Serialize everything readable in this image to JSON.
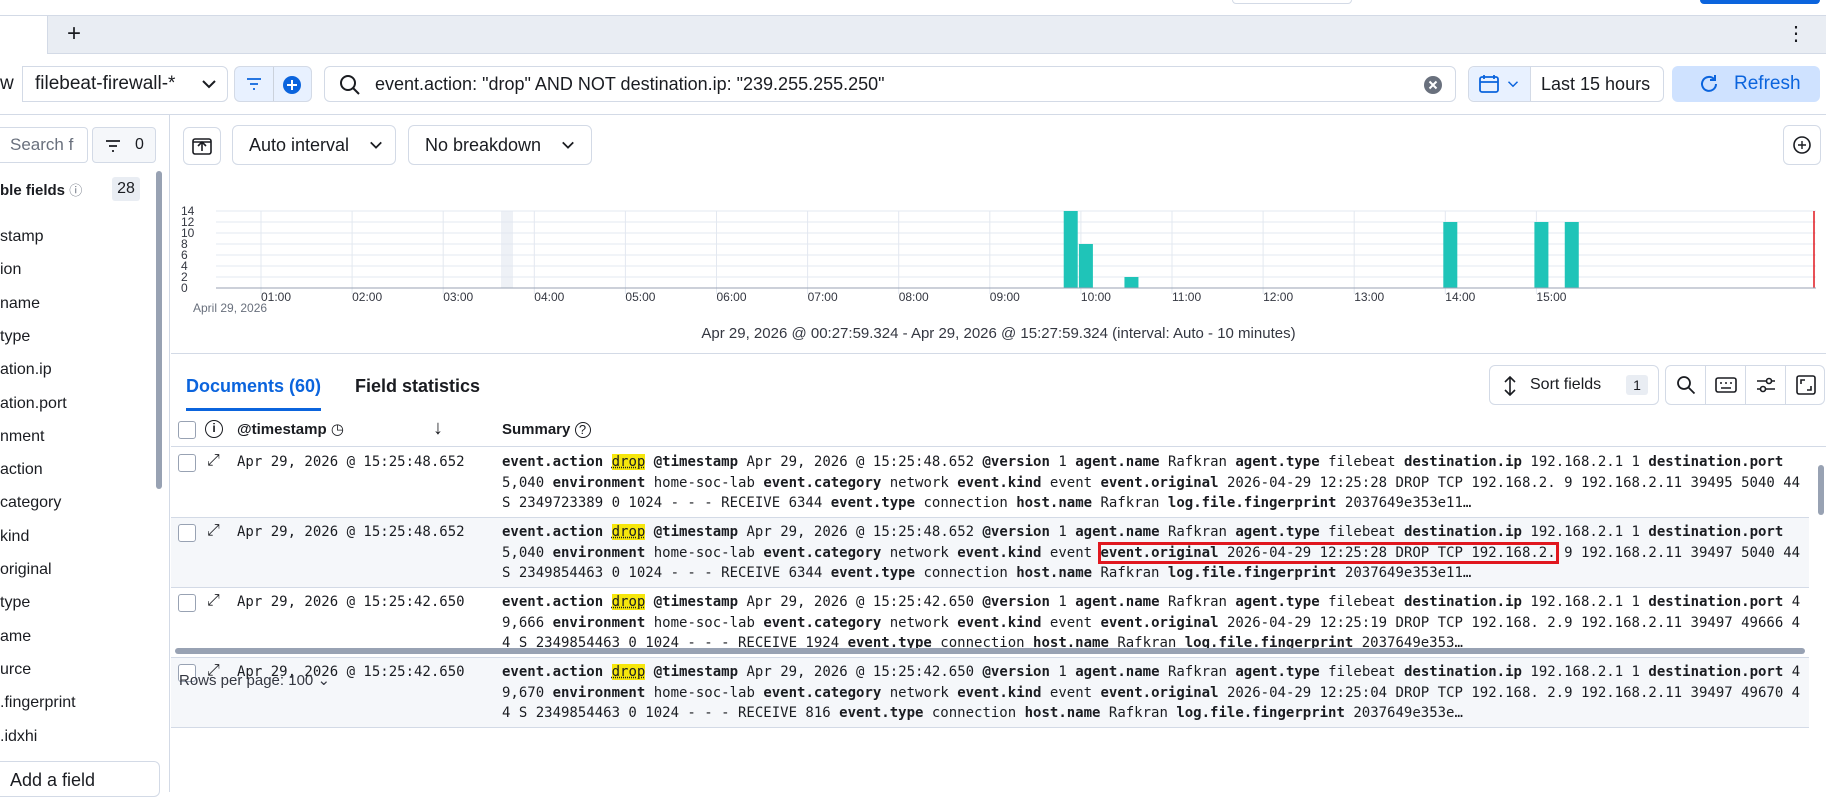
{
  "tabbar": {
    "add_tab": "+",
    "more": "⋮"
  },
  "query": {
    "dataview_prefix": "w",
    "dataview": "filebeat-firewall-*",
    "text": "event.action: \"drop\" AND NOT destination.ip: \"239.255.255.250\"",
    "date_range": "Last 15 hours",
    "refresh": "Refresh"
  },
  "sidebar": {
    "search_placeholder": "Search f",
    "filter_count": "0",
    "section_label": "ble fields",
    "section_count": "28",
    "items": [
      "stamp",
      "ion",
      "name",
      "type",
      "ation.ip",
      "ation.port",
      "nment",
      "action",
      "category",
      "kind",
      "original",
      "type",
      "ame",
      "urce",
      ".fingerprint",
      ".idxhi"
    ],
    "add_field": "Add a field"
  },
  "toolbar": {
    "interval": "Auto interval",
    "breakdown": "No breakdown"
  },
  "chart_data": {
    "type": "bar",
    "y_ticks": [
      "14",
      "12",
      "10",
      "8",
      "6",
      "4",
      "2",
      "0"
    ],
    "x_ticks": [
      "01:00",
      "02:00",
      "03:00",
      "04:00",
      "05:00",
      "06:00",
      "07:00",
      "08:00",
      "09:00",
      "10:00",
      "11:00",
      "12:00",
      "13:00",
      "14:00",
      "15:00"
    ],
    "x_date_label": "April 29, 2026",
    "ylim": [
      0,
      14
    ],
    "bars": [
      {
        "time": "09:50",
        "value": 14
      },
      {
        "time": "10:00",
        "value": 8
      },
      {
        "time": "10:30",
        "value": 2
      },
      {
        "time": "14:00",
        "value": 12
      },
      {
        "time": "15:00",
        "value": 12
      },
      {
        "time": "15:20",
        "value": 12
      }
    ],
    "color": "#1fc4b8",
    "grid": true
  },
  "interval_text": "Apr 29, 2026 @ 00:27:59.324 - Apr 29, 2026 @ 15:27:59.324 (interval: Auto - 10 minutes)",
  "tabs": {
    "documents": "Documents (60)",
    "field_stats": "Field statistics"
  },
  "sort": {
    "label": "Sort fields",
    "count": "1"
  },
  "table": {
    "col_timestamp": "@timestamp",
    "col_summary": "Summary",
    "rows": [
      {
        "ts": "Apr 29, 2026 @ 15:25:48.652",
        "a": "event.action ",
        "hl": "drop",
        "b": " @timestamp Apr 29, 2026 @ 15:25:48.652 @version 1 agent.name Rafkran agent.type filebeat destination.ip 192.168.2.1 1 destination.port 5,040 environment home-soc-lab event.category network event.kind event ",
        "c": "event.original 2026-04-29 12:25:28 DROP TCP 192.168.2.",
        "d": " 9 192.168.2.11 39495 5040 44 S 2349723389 0 1024 - - - RECEIVE 6344 event.type connection host.name Rafkran log.file.fingerprint 2037649e353e11…",
        "boxed": false
      },
      {
        "ts": "Apr 29, 2026 @ 15:25:48.652",
        "a": "event.action ",
        "hl": "drop",
        "b": " @timestamp Apr 29, 2026 @ 15:25:48.652 @version 1 agent.name Rafkran agent.type filebeat destination.ip 192.168.2.1 1 destination.port 5,040 environment home-soc-lab event.category network event.kind event ",
        "c": "event.original 2026-04-29 12:25:28 DROP TCP 192.168.2.",
        "d": " 9 192.168.2.11 39497 5040 44 S 2349854463 0 1024 - - - RECEIVE 6344 event.type connection host.name Rafkran log.file.fingerprint 2037649e353e11…",
        "boxed": true
      },
      {
        "ts": "Apr 29, 2026 @ 15:25:42.650",
        "a": "event.action ",
        "hl": "drop",
        "b": " @timestamp Apr 29, 2026 @ 15:25:42.650 @version 1 agent.name Rafkran agent.type filebeat destination.ip 192.168.2.1 1 destination.port 49,666 environment home-soc-lab event.category network event.kind event ",
        "c": "event.original 2026-04-29 12:25:19 DROP TCP 192.168.",
        "d": " 2.9 192.168.2.11 39497 49666 44 S 2349854463 0 1024 - - - RECEIVE 1924 event.type connection host.name Rafkran log.file.fingerprint 2037649e353…",
        "boxed": false
      },
      {
        "ts": "Apr 29, 2026 @ 15:25:42.650",
        "a": "event.action ",
        "hl": "drop",
        "b": " @timestamp Apr 29, 2026 @ 15:25:42.650 @version 1 agent.name Rafkran agent.type filebeat destination.ip 192.168.2.1 1 destination.port 49,670 environment home-soc-lab event.category network event.kind event ",
        "c": "event.original 2026-04-29 12:25:04 DROP TCP 192.168.",
        "d": " 2.9 192.168.2.11 39497 49670 44 S 2349854463 0 1024 - - - RECEIVE 816 event.type connection host.name Rafkran log.file.fingerprint 2037649e353e…",
        "boxed": false
      }
    ]
  },
  "pager": {
    "rows_per_page": "Rows per page: 100"
  }
}
